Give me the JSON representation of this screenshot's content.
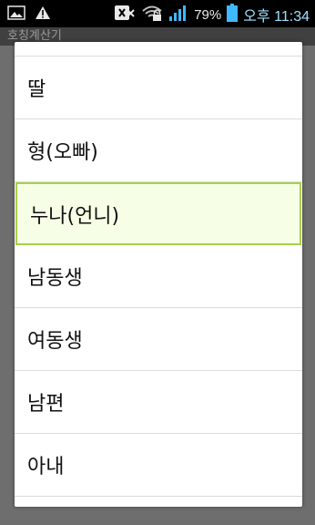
{
  "status_bar": {
    "battery_percent": "79%",
    "time": "오후 11:34",
    "icons": [
      "image-icon",
      "warning-icon",
      "no-sim-icon",
      "wifi-icon",
      "signal-icon",
      "battery-icon"
    ]
  },
  "app": {
    "title": "호칭계산기"
  },
  "dialog": {
    "items": [
      {
        "label": ""
      },
      {
        "label": "딸"
      },
      {
        "label": "형(오빠)"
      },
      {
        "label": "누나(언니)"
      },
      {
        "label": "남동생"
      },
      {
        "label": "여동생"
      },
      {
        "label": "남편"
      },
      {
        "label": "아내"
      }
    ],
    "selected_index": 3,
    "selected_color": "#a8d04a"
  }
}
